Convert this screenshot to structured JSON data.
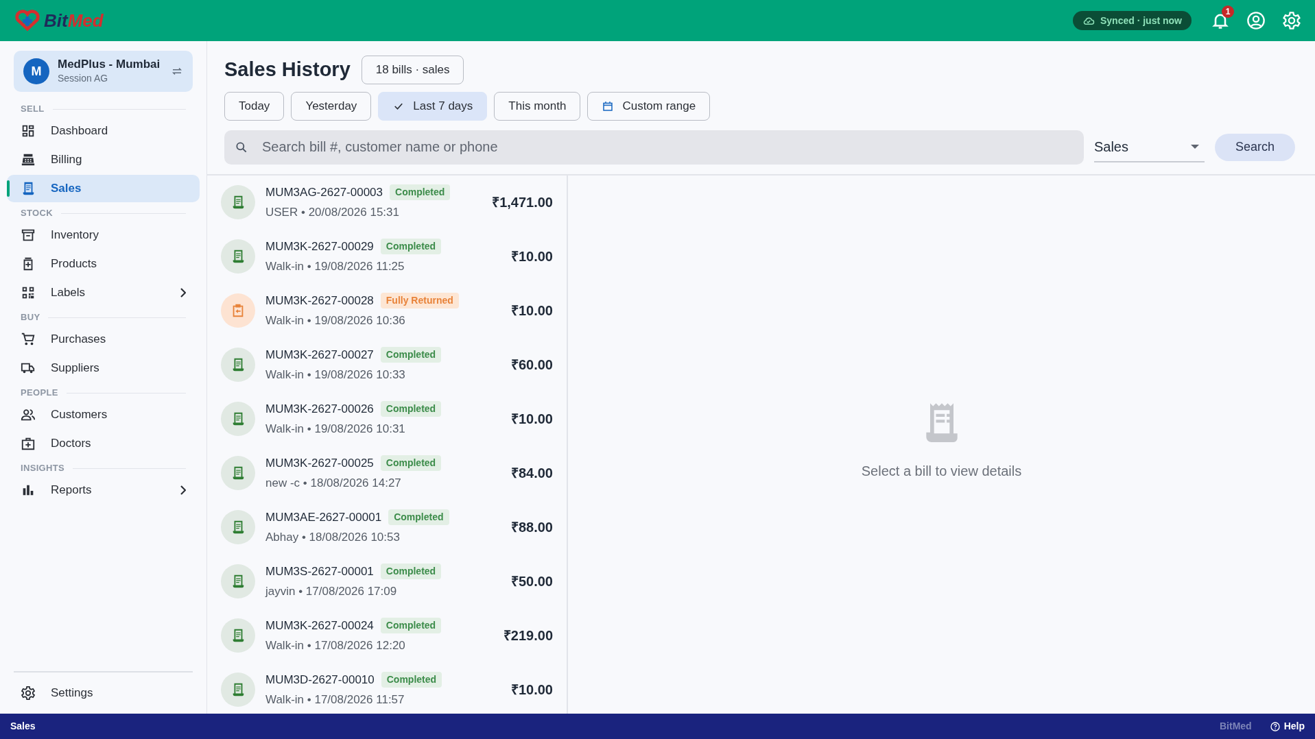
{
  "brand": {
    "text_start": "Bit",
    "text_end": "Med"
  },
  "topbar": {
    "sync": "Synced · just now",
    "notifications": "1"
  },
  "store": {
    "avatar": "M",
    "name": "MedPlus - Mumbai",
    "session": "Session AG"
  },
  "sidebar": {
    "sections": [
      {
        "title": "SELL",
        "items": [
          {
            "label": "Dashboard",
            "selected": false,
            "submenu": false
          },
          {
            "label": "Billing",
            "selected": false,
            "submenu": false
          },
          {
            "label": "Sales",
            "selected": true,
            "submenu": false
          }
        ]
      },
      {
        "title": "STOCK",
        "items": [
          {
            "label": "Inventory",
            "selected": false,
            "submenu": false
          },
          {
            "label": "Products",
            "selected": false,
            "submenu": false
          },
          {
            "label": "Labels",
            "selected": false,
            "submenu": true
          }
        ]
      },
      {
        "title": "BUY",
        "items": [
          {
            "label": "Purchases",
            "selected": false,
            "submenu": false
          },
          {
            "label": "Suppliers",
            "selected": false,
            "submenu": false
          }
        ]
      },
      {
        "title": "PEOPLE",
        "items": [
          {
            "label": "Customers",
            "selected": false,
            "submenu": false
          },
          {
            "label": "Doctors",
            "selected": false,
            "submenu": false
          }
        ]
      },
      {
        "title": "INSIGHTS",
        "items": [
          {
            "label": "Reports",
            "selected": false,
            "submenu": true
          }
        ]
      }
    ],
    "footer": {
      "label": "Settings"
    }
  },
  "page": {
    "title": "Sales History",
    "count": "18 bills · sales",
    "filters": [
      {
        "label": "Today",
        "kind": "plain",
        "selected": false
      },
      {
        "label": "Yesterday",
        "kind": "plain",
        "selected": false
      },
      {
        "label": "Last 7 days",
        "kind": "plain",
        "selected": true
      },
      {
        "label": "This month",
        "kind": "plain",
        "selected": false
      },
      {
        "label": "Custom range",
        "kind": "calendar",
        "selected": false
      }
    ],
    "search": {
      "placeholder": "Search bill #, customer name or phone"
    },
    "type_select": "Sales",
    "search_button": "Search"
  },
  "bills": [
    {
      "number": "MUM3AG-2627-00003",
      "status": "Completed",
      "kind": "completed",
      "meta": "USER • 20/08/2026 15:31",
      "amount": "₹1,471.00"
    },
    {
      "number": "MUM3K-2627-00029",
      "status": "Completed",
      "kind": "completed",
      "meta": "Walk-in • 19/08/2026 11:25",
      "amount": "₹10.00"
    },
    {
      "number": "MUM3K-2627-00028",
      "status": "Fully Returned",
      "kind": "returned",
      "meta": "Walk-in • 19/08/2026 10:36",
      "amount": "₹10.00"
    },
    {
      "number": "MUM3K-2627-00027",
      "status": "Completed",
      "kind": "completed",
      "meta": "Walk-in • 19/08/2026 10:33",
      "amount": "₹60.00"
    },
    {
      "number": "MUM3K-2627-00026",
      "status": "Completed",
      "kind": "completed",
      "meta": "Walk-in • 19/08/2026 10:31",
      "amount": "₹10.00"
    },
    {
      "number": "MUM3K-2627-00025",
      "status": "Completed",
      "kind": "completed",
      "meta": "new -c • 18/08/2026 14:27",
      "amount": "₹84.00"
    },
    {
      "number": "MUM3AE-2627-00001",
      "status": "Completed",
      "kind": "completed",
      "meta": "Abhay • 18/08/2026 10:53",
      "amount": "₹88.00"
    },
    {
      "number": "MUM3S-2627-00001",
      "status": "Completed",
      "kind": "completed",
      "meta": "jayvin • 17/08/2026 17:09",
      "amount": "₹50.00"
    },
    {
      "number": "MUM3K-2627-00024",
      "status": "Completed",
      "kind": "completed",
      "meta": "Walk-in • 17/08/2026 12:20",
      "amount": "₹219.00"
    },
    {
      "number": "MUM3D-2627-00010",
      "status": "Completed",
      "kind": "completed",
      "meta": "Walk-in • 17/08/2026 11:57",
      "amount": "₹10.00"
    }
  ],
  "detail": {
    "empty_message": "Select a bill to view details"
  },
  "status_bar": {
    "page": "Sales",
    "app": "BitMed",
    "help": "Help"
  }
}
